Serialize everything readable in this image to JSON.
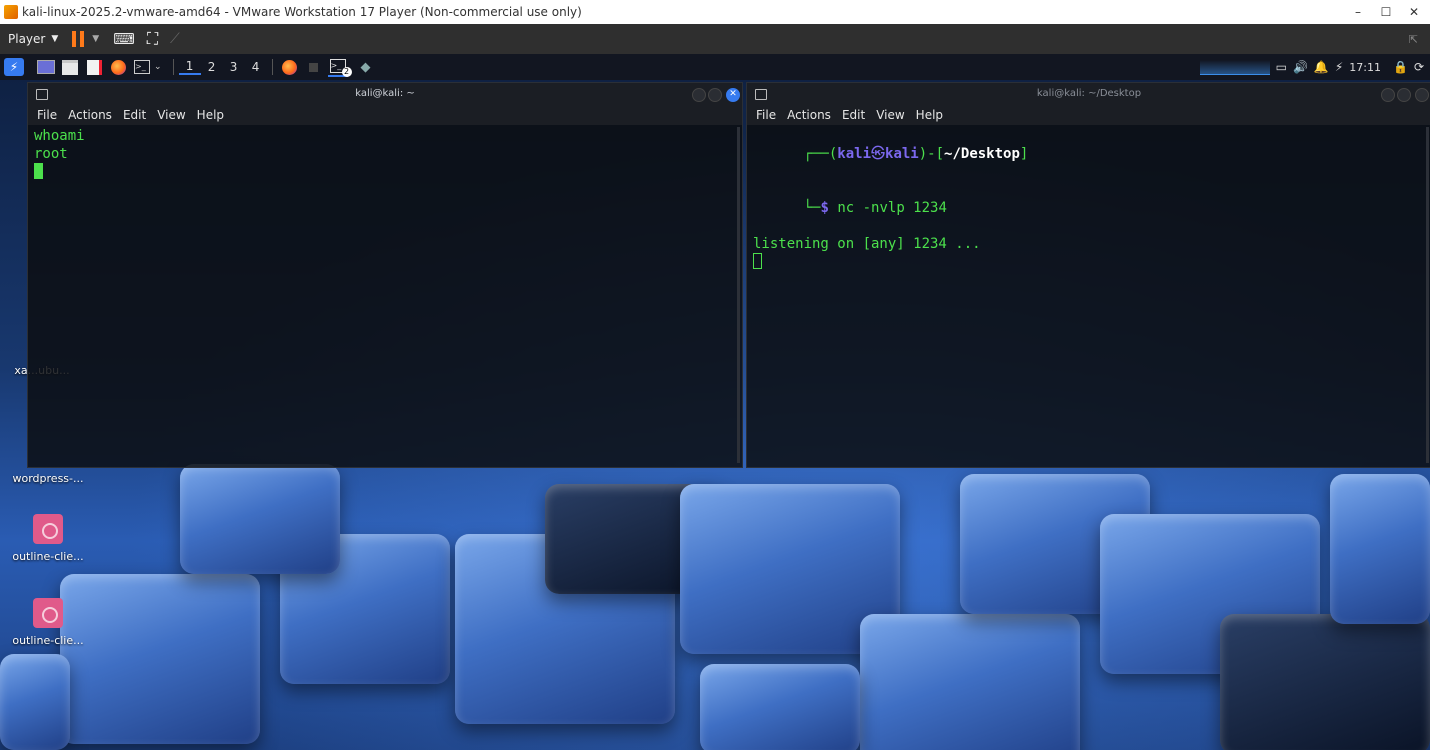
{
  "vm": {
    "title": "kali-linux-2025.2-vmware-amd64 - VMware Workstation 17 Player (Non-commercial use only)",
    "player_label": "Player",
    "controls": {
      "minimize": "–",
      "maximize": "☐",
      "close": "✕"
    },
    "fullscreen_hint": "⇱"
  },
  "panel": {
    "workspaces": [
      "1",
      "2",
      "3",
      "4"
    ],
    "terminal_badge": "2",
    "clock": "17:11"
  },
  "terminal_left": {
    "title": "kali@kali: ~",
    "menu": [
      "File",
      "Actions",
      "Edit",
      "View",
      "Help"
    ],
    "lines": [
      "whoami",
      "root"
    ]
  },
  "terminal_right": {
    "title": "kali@kali: ~/Desktop",
    "menu": [
      "File",
      "Actions",
      "Edit",
      "View",
      "Help"
    ],
    "prompt": {
      "open": "┌──(",
      "user": "kali",
      "at": "㉿",
      "host": "kali",
      "mid": ")-[",
      "path": "~/Desktop",
      "close": "]",
      "branch": "└─",
      "dollar": "$",
      "command": "nc -nvlp 1234"
    },
    "output": "listening on [any] 1234 ..."
  },
  "desktop_icons": [
    {
      "label": "xa...ubu..."
    },
    {
      "label": "wordpress-..."
    },
    {
      "label": "outline-clie..."
    },
    {
      "label": "outline-clie..."
    }
  ],
  "colors": {
    "terminal_green": "#4ce04c",
    "prompt_blue": "#3b8eea",
    "vm_accent": "#ff7a1a"
  }
}
